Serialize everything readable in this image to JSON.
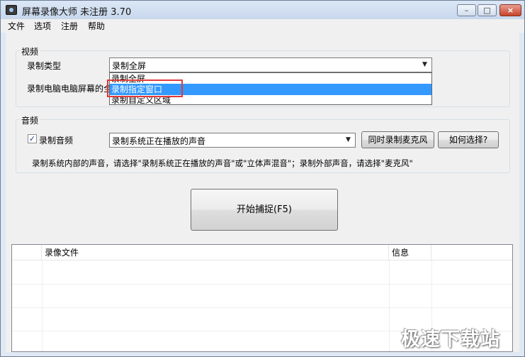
{
  "window": {
    "title": "屏幕录像大师 未注册 3.70",
    "controls": {
      "minimize": "–",
      "maximize": "□",
      "close": "×"
    }
  },
  "menu": {
    "items": [
      "文件",
      "选项",
      "注册",
      "帮助"
    ]
  },
  "video_group": {
    "title": "视频",
    "record_type_label": "录制类型",
    "record_type_value": "录制全屏",
    "desc_label": "录制电脑电脑屏幕的全",
    "dropdown_options": [
      "录制全屏",
      "录制指定窗口",
      "录制自定义区域"
    ],
    "dropdown_selected_index": 1
  },
  "audio_group": {
    "title": "音频",
    "record_audio_label": "录制音频",
    "record_audio_checked": true,
    "audio_source_value": "录制系统正在播放的声音",
    "mic_button": "同时录制麦克风",
    "how_button": "如何选择?",
    "hint": "录制系统内部的声音，请选择\"录制系统正在播放的声音\"或\"立体声混音\"；录制外部声音，请选择\"麦克风\""
  },
  "capture_button": "开始捕捉(F5)",
  "file_list": {
    "columns": [
      "",
      "录像文件",
      "信息"
    ],
    "rows": []
  },
  "watermark": "极速下载站",
  "colors": {
    "selection": "#3399ff",
    "highlight_box": "#e03a3a",
    "close_button": "#c7432b"
  },
  "icons": [
    "app-icon",
    "minimize-icon",
    "maximize-icon",
    "close-icon",
    "dropdown-arrow-icon",
    "checkmark-icon"
  ]
}
